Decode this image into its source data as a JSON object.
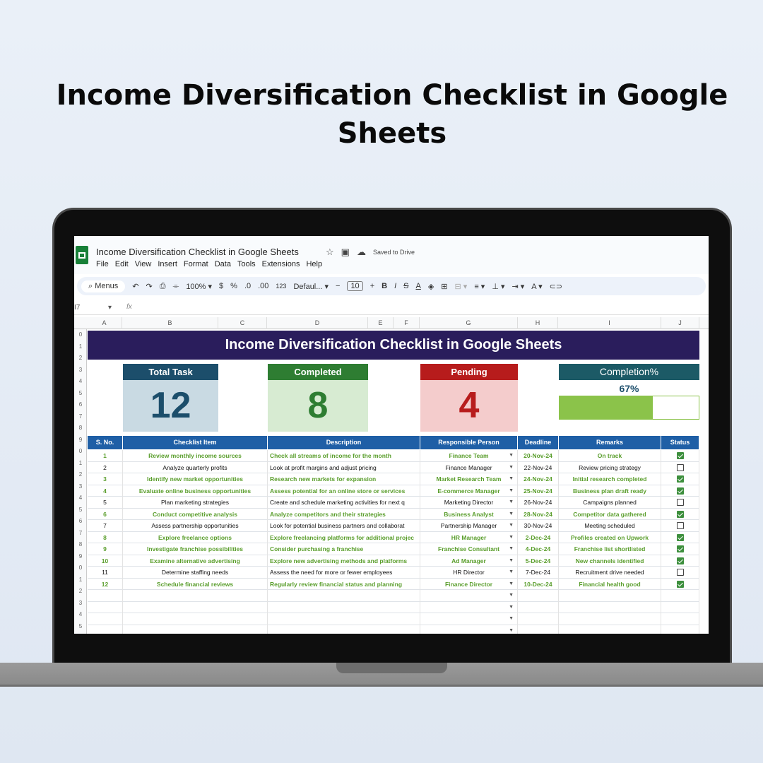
{
  "promo": {
    "title": "Income Diversification Checklist in Google Sheets"
  },
  "sheets": {
    "doc_title": "Income Diversification Checklist in Google Sheets",
    "saved_status": "Saved to Drive",
    "menu": [
      "File",
      "Edit",
      "View",
      "Insert",
      "Format",
      "Data",
      "Tools",
      "Extensions",
      "Help"
    ],
    "toolbar": {
      "menus_label": "Menus",
      "zoom": "100%",
      "currency": "$",
      "percent": "%",
      "dec_less": ".0",
      "dec_more": ".00",
      "number_format": "123",
      "font": "Defaul...",
      "font_size": "10"
    },
    "name_box": "I7",
    "fx": "fx",
    "columns": [
      "A",
      "B",
      "C",
      "D",
      "E",
      "F",
      "G",
      "H",
      "I",
      "J"
    ],
    "row_numbers": [
      "0",
      "1",
      "2",
      "3",
      "4",
      "5",
      "6",
      "7",
      "8",
      "9",
      "0",
      "1",
      "2",
      "3",
      "4",
      "5",
      "6",
      "7",
      "8",
      "9",
      "0",
      "1",
      "2",
      "3",
      "4",
      "5"
    ]
  },
  "dashboard": {
    "banner": "Income Diversification Checklist in Google Sheets",
    "cards": {
      "total": {
        "label": "Total Task",
        "value": "12"
      },
      "completed": {
        "label": "Completed",
        "value": "8"
      },
      "pending": {
        "label": "Pending",
        "value": "4"
      },
      "completion": {
        "label": "Completion%",
        "value": "67%",
        "fraction": 0.67
      }
    },
    "colors": {
      "banner": "#2a1d5c",
      "total_head": "#1c4e6b",
      "total_body": "#c9dae3",
      "completed_head": "#2e7d32",
      "completed_body": "#d7ebd2",
      "pending_head": "#b71c1c",
      "pending_body": "#f4cccc",
      "table_head": "#1f5fa6",
      "done_text": "#5a9e2c",
      "progress": "#8bc34a"
    }
  },
  "table": {
    "headers": [
      "S. No.",
      "Checklist Item",
      "Description",
      "Responsible Person",
      "Deadline",
      "Remarks",
      "Status"
    ],
    "rows": [
      {
        "sno": "1",
        "item": "Review monthly income sources",
        "desc": "Check all streams of income for the month",
        "person": "Finance Team",
        "deadline": "20-Nov-24",
        "remarks": "On track",
        "done": true
      },
      {
        "sno": "2",
        "item": "Analyze quarterly profits",
        "desc": "Look at profit margins and adjust pricing",
        "person": "Finance Manager",
        "deadline": "22-Nov-24",
        "remarks": "Review pricing strategy",
        "done": false
      },
      {
        "sno": "3",
        "item": "Identify new market opportunities",
        "desc": "Research new markets for expansion",
        "person": "Market Research Team",
        "deadline": "24-Nov-24",
        "remarks": "Initial research completed",
        "done": true
      },
      {
        "sno": "4",
        "item": "Evaluate online business opportunities",
        "desc": "Assess potential for an online store or services",
        "person": "E-commerce Manager",
        "deadline": "25-Nov-24",
        "remarks": "Business plan draft ready",
        "done": true
      },
      {
        "sno": "5",
        "item": "Plan marketing strategies",
        "desc": "Create and schedule marketing activities for next q",
        "person": "Marketing Director",
        "deadline": "26-Nov-24",
        "remarks": "Campaigns planned",
        "done": false
      },
      {
        "sno": "6",
        "item": "Conduct competitive analysis",
        "desc": "Analyze competitors and their strategies",
        "person": "Business Analyst",
        "deadline": "28-Nov-24",
        "remarks": "Competitor data gathered",
        "done": true
      },
      {
        "sno": "7",
        "item": "Assess partnership opportunities",
        "desc": "Look for potential business partners and collaborat",
        "person": "Partnership Manager",
        "deadline": "30-Nov-24",
        "remarks": "Meeting scheduled",
        "done": false
      },
      {
        "sno": "8",
        "item": "Explore freelance options",
        "desc": "Explore freelancing platforms for additional projec",
        "person": "HR Manager",
        "deadline": "2-Dec-24",
        "remarks": "Profiles created on Upwork",
        "done": true
      },
      {
        "sno": "9",
        "item": "Investigate franchise possibilities",
        "desc": "Consider purchasing a franchise",
        "person": "Franchise Consultant",
        "deadline": "4-Dec-24",
        "remarks": "Franchise list shortlisted",
        "done": true
      },
      {
        "sno": "10",
        "item": "Examine alternative advertising",
        "desc": "Explore new advertising methods and platforms",
        "person": "Ad Manager",
        "deadline": "5-Dec-24",
        "remarks": "New channels identified",
        "done": true
      },
      {
        "sno": "11",
        "item": "Determine staffing needs",
        "desc": "Assess the need for more or fewer employees",
        "person": "HR Director",
        "deadline": "7-Dec-24",
        "remarks": "Recruitment drive needed",
        "done": false
      },
      {
        "sno": "12",
        "item": "Schedule financial reviews",
        "desc": "Regularly review financial status and planning",
        "person": "Finance Director",
        "deadline": "10-Dec-24",
        "remarks": "Financial health good",
        "done": true
      }
    ],
    "empty_rows": 4
  }
}
